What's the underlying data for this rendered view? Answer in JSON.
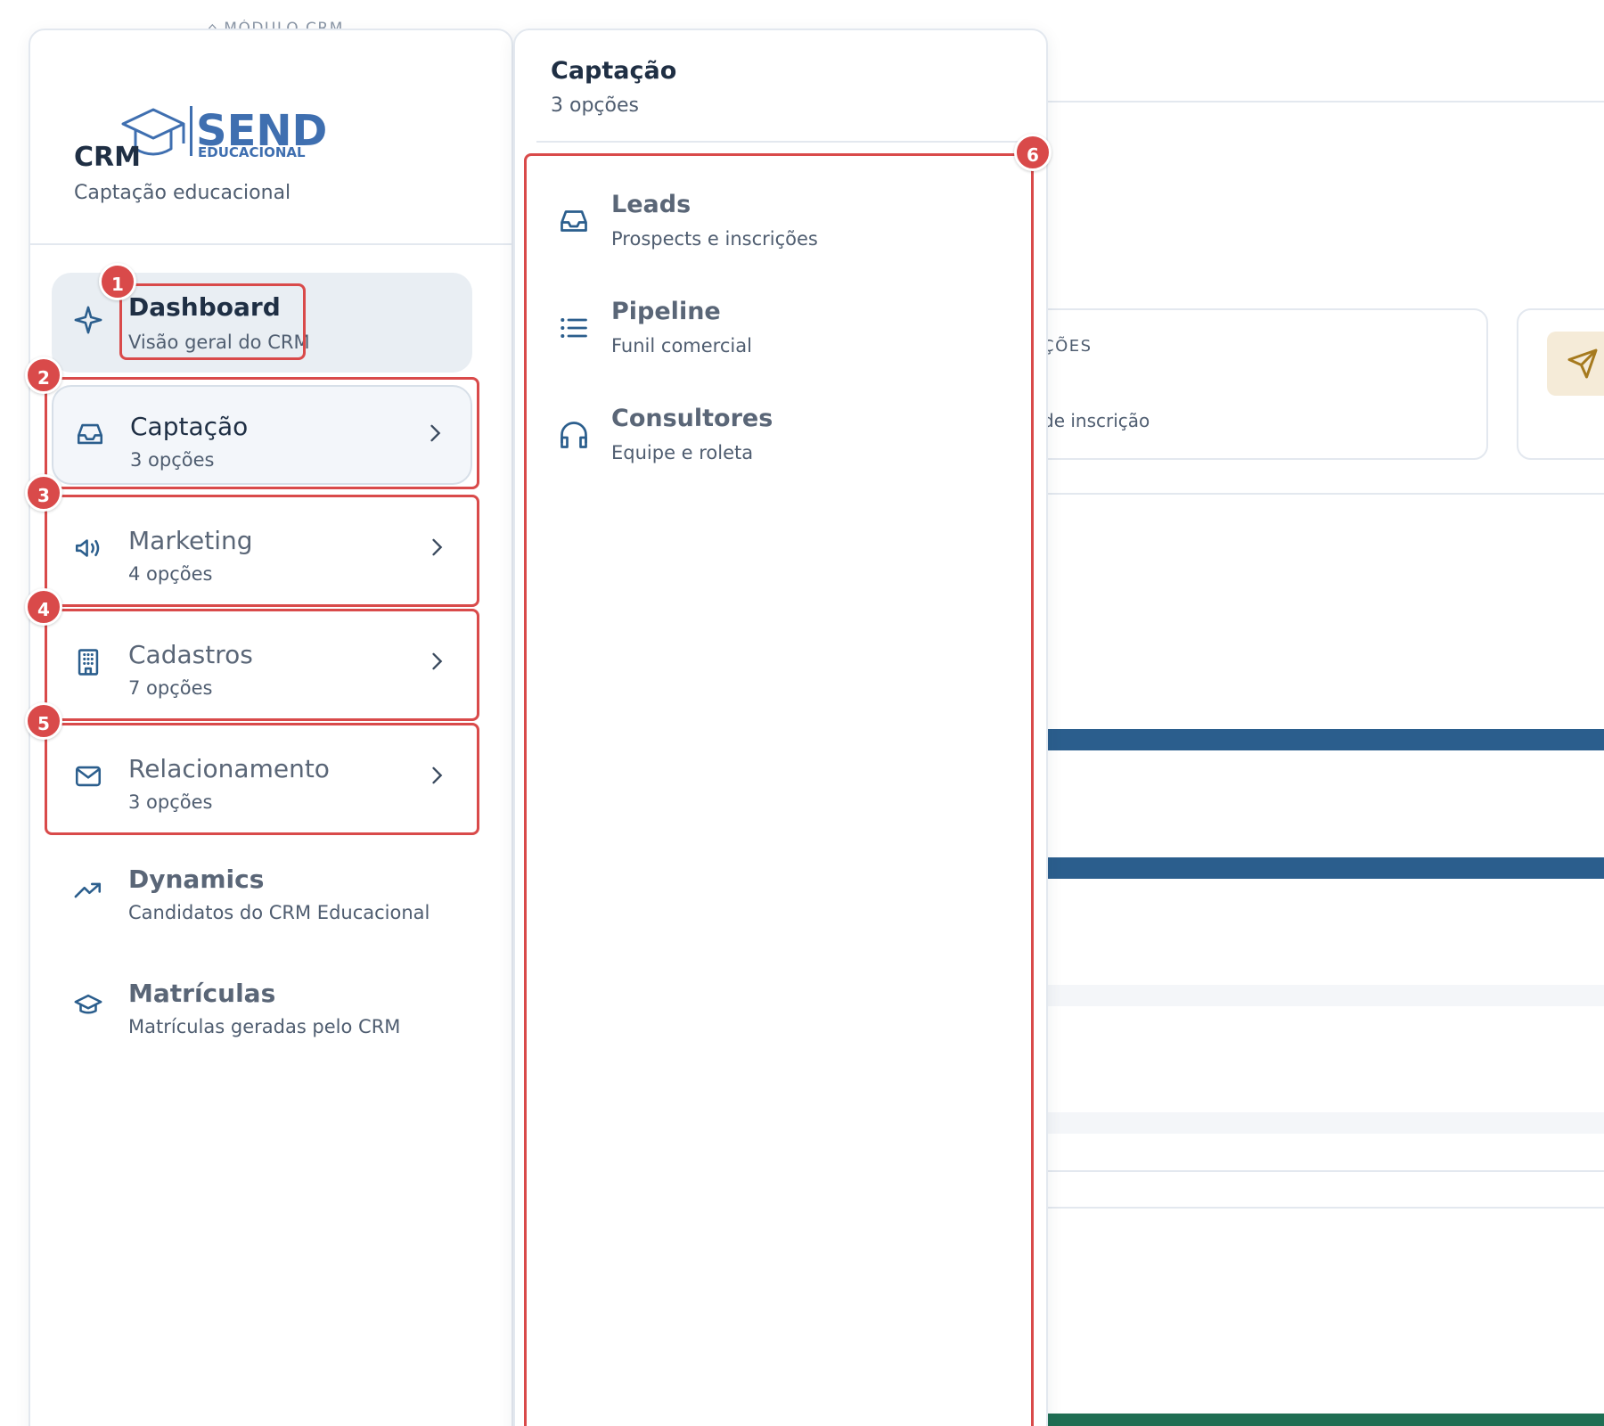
{
  "background": {
    "breadcrumb": "MÓDULO CRM",
    "card_label": "ÇÕES",
    "card_sub": "de inscrição"
  },
  "brand": {
    "logo_word": "SEND",
    "logo_sub": "EDUCACIONAL",
    "logo_color": "#3f6fb0"
  },
  "app": {
    "title": "CRM",
    "subtitle": "Captação educacional"
  },
  "sidebar": {
    "items": [
      {
        "label": "Dashboard",
        "sub": "Visão geral do CRM",
        "icon": "sparkle-icon"
      },
      {
        "label": "Captação",
        "sub": "3 opções",
        "icon": "inbox-icon"
      },
      {
        "label": "Marketing",
        "sub": "4 opções",
        "icon": "megaphone-icon"
      },
      {
        "label": "Cadastros",
        "sub": "7 opções",
        "icon": "building-icon"
      },
      {
        "label": "Relacionamento",
        "sub": "3 opções",
        "icon": "mail-icon"
      },
      {
        "label": "Dynamics",
        "sub": "Candidatos do CRM Educacional",
        "icon": "trending-up-icon"
      },
      {
        "label": "Matrículas",
        "sub": "Matrículas geradas pelo CRM",
        "icon": "graduation-cap-icon"
      }
    ]
  },
  "submenu": {
    "title": "Captação",
    "subtitle": "3 opções",
    "items": [
      {
        "label": "Leads",
        "sub": "Prospects e inscrições",
        "icon": "inbox-icon"
      },
      {
        "label": "Pipeline",
        "sub": "Funil comercial",
        "icon": "list-icon"
      },
      {
        "label": "Consultores",
        "sub": "Equipe e roleta",
        "icon": "headphones-icon"
      }
    ]
  },
  "annotations": [
    "1",
    "2",
    "3",
    "4",
    "5",
    "6"
  ],
  "colors": {
    "accent": "#2b5e8d",
    "highlight": "#d94a4a",
    "active_bg": "#e9eef3"
  }
}
